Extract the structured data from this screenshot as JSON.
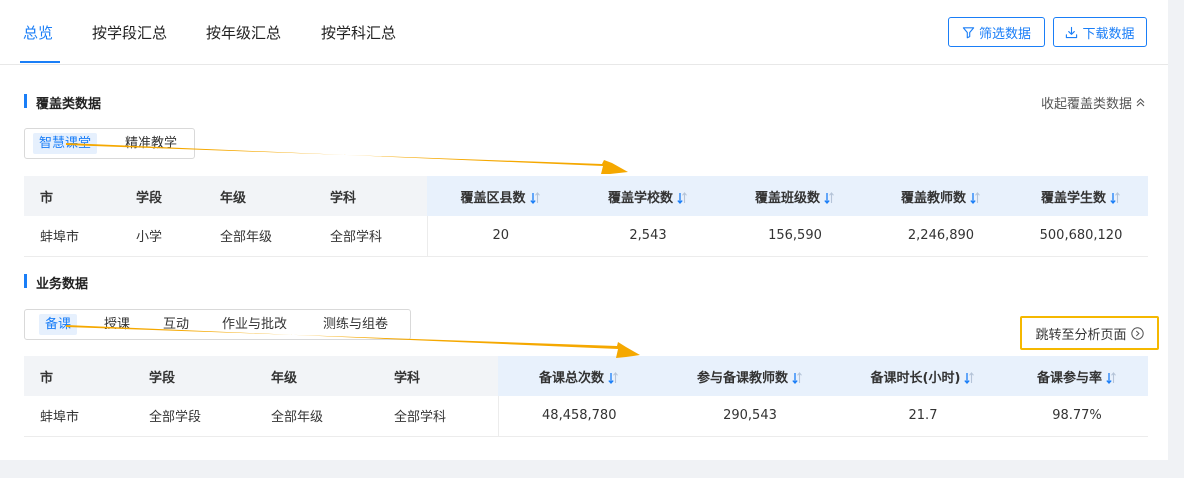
{
  "top_tabs": [
    {
      "label": "总览",
      "active": true
    },
    {
      "label": "按学段汇总",
      "active": false
    },
    {
      "label": "按年级汇总",
      "active": false
    },
    {
      "label": "按学科汇总",
      "active": false
    }
  ],
  "toolbar": {
    "filter_label": "筛选数据",
    "download_label": "下载数据",
    "accent_color": "#1a7ef7"
  },
  "coverage": {
    "title": "覆盖类数据",
    "collapse_label": "收起覆盖类数据",
    "subtabs": [
      {
        "label": "智慧课堂",
        "active": true
      },
      {
        "label": "精准教学",
        "active": false
      }
    ],
    "columns": [
      "市",
      "学段",
      "年级",
      "学科",
      "覆盖区县数",
      "覆盖学校数",
      "覆盖班级数",
      "覆盖教师数",
      "覆盖学生数"
    ],
    "rows": [
      [
        "蚌埠市",
        "小学",
        "全部年级",
        "全部学科",
        "20",
        "2,543",
        "156,590",
        "2,246,890",
        "500,680,120"
      ]
    ]
  },
  "business": {
    "title": "业务数据",
    "jump_label": "跳转至分析页面",
    "highlight_color": "#f5b800",
    "subtabs": [
      {
        "label": "备课",
        "active": true
      },
      {
        "label": "授课",
        "active": false
      },
      {
        "label": "互动",
        "active": false
      },
      {
        "label": "作业与批改",
        "active": false
      },
      {
        "label": "测练与组卷",
        "active": false
      }
    ],
    "columns": [
      "市",
      "学段",
      "年级",
      "学科",
      "备课总次数",
      "参与备课教师数",
      "备课时长(小时)",
      "备课参与率"
    ],
    "rows": [
      [
        "蚌埠市",
        "全部学段",
        "全部年级",
        "全部学科",
        "48,458,780",
        "290,543",
        "21.7",
        "98.77%"
      ]
    ]
  },
  "annotation_color": "#f5a800"
}
